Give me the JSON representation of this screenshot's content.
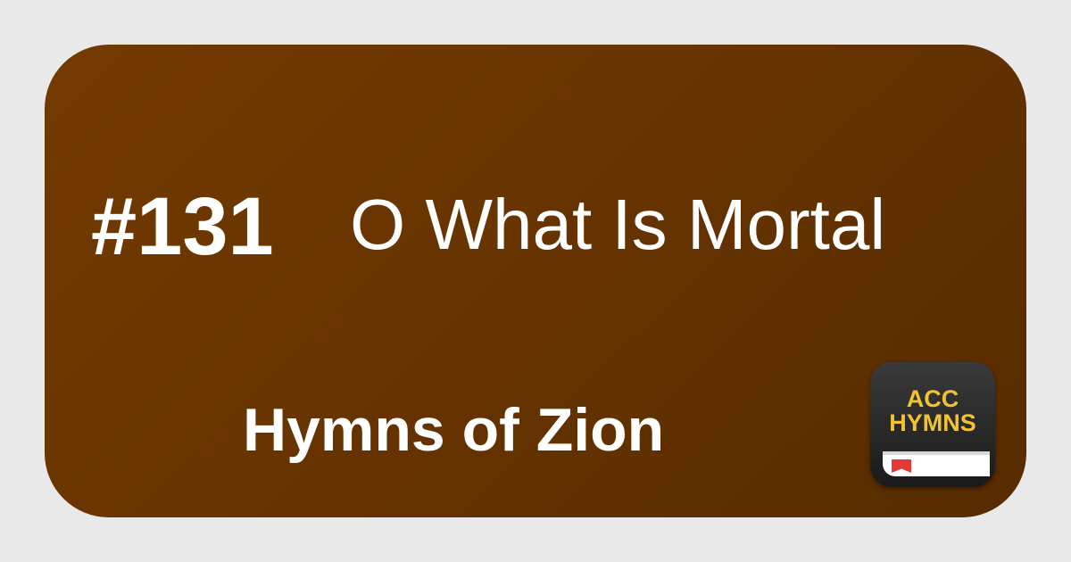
{
  "hymn": {
    "number": "#131",
    "title": "O What Is Mortal"
  },
  "book": {
    "name": "Hymns of Zion"
  },
  "app_icon": {
    "line1": "ACC",
    "line2": "HYMNS",
    "text_color": "#f1c232",
    "bookmark_color": "#e53935"
  },
  "colors": {
    "card_background": "#663300",
    "frame_background": "#e9e9e9",
    "text": "#ffffff"
  }
}
